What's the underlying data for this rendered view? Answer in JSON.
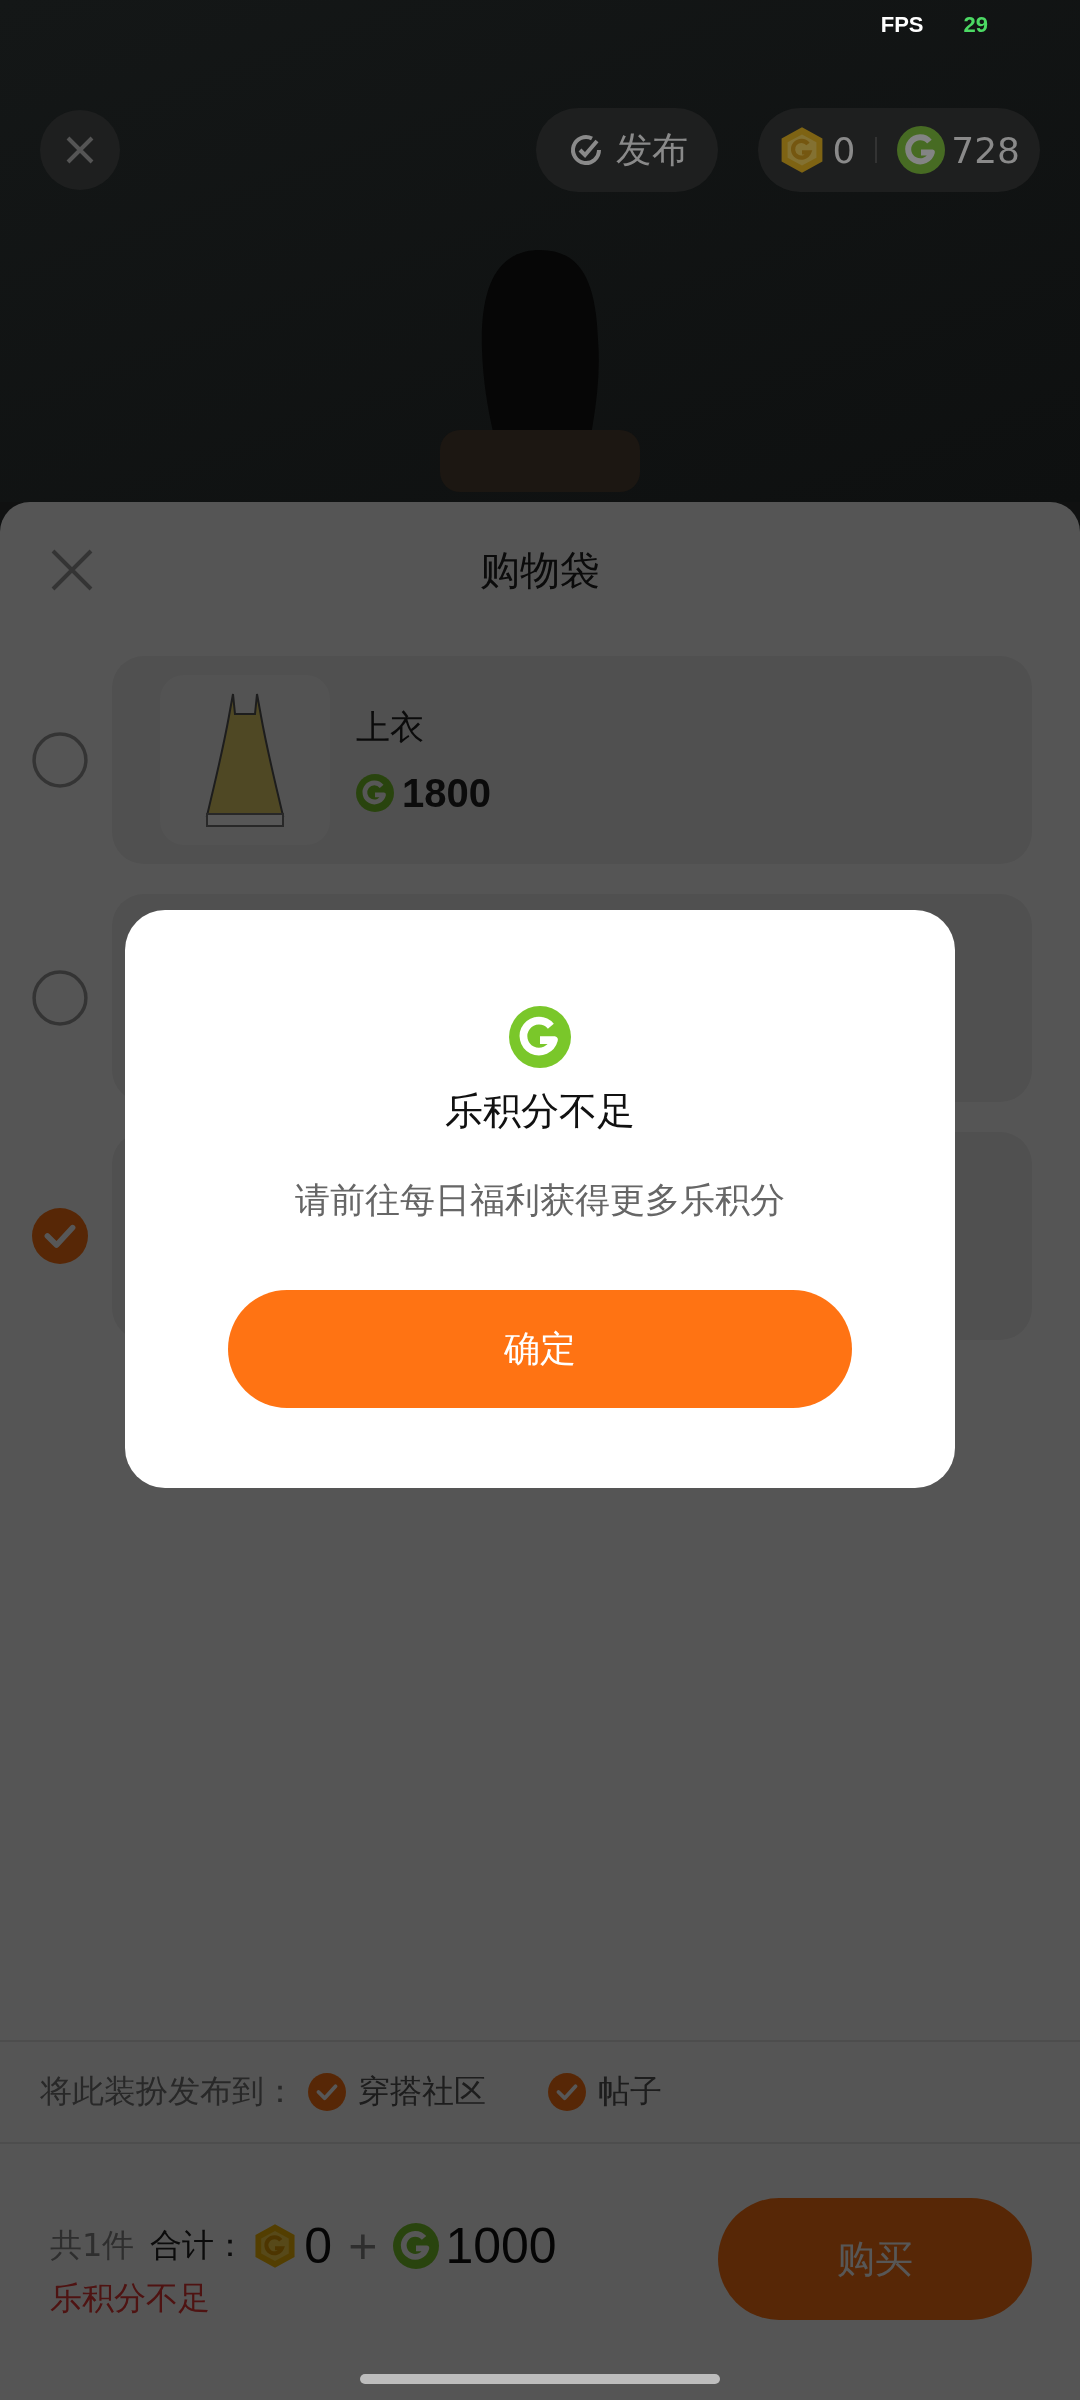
{
  "status": {
    "fps_label": "FPS",
    "fps_value": "29"
  },
  "top_bar": {
    "publish": "发布",
    "gold_balance": "0",
    "green_balance": "728"
  },
  "sheet": {
    "title": "购物袋",
    "items": [
      {
        "name": "上衣",
        "price": "1800",
        "selected": false
      },
      {
        "selected": false
      },
      {
        "selected": true
      }
    ],
    "publish": {
      "label": "将此装扮发布到：",
      "targets": [
        {
          "label": "穿搭社区",
          "checked": true
        },
        {
          "label": "帖子",
          "checked": true
        }
      ]
    },
    "footer": {
      "count": "共1件",
      "total_label": "合计：",
      "gold": "0",
      "plus": "+",
      "green": "1000",
      "warning": "乐积分不足",
      "buy": "购买"
    }
  },
  "dialog": {
    "title": "乐积分不足",
    "message": "请前往每日福利获得更多乐积分",
    "confirm": "确定"
  }
}
